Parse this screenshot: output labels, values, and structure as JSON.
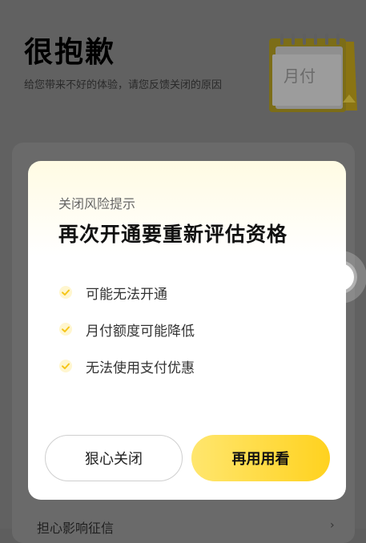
{
  "header": {
    "title": "很抱歉",
    "subtitle": "给您带来不好的体验，请您反馈关闭的原因",
    "calendar_text": "月付"
  },
  "background": {
    "bottom_item": "担心影响征信",
    "bottom_arrow": "›"
  },
  "modal": {
    "label": "关闭风险提示",
    "title": "再次开通要重新评估资格",
    "items": [
      {
        "text": "可能无法开通"
      },
      {
        "text": "月付额度可能降低"
      },
      {
        "text": "无法使用支付优惠"
      }
    ],
    "close_button": "狠心关闭",
    "retry_button": "再用用看"
  },
  "colors": {
    "accent": "#ffd21f",
    "check": "#f5c518",
    "overlay": "#616161"
  }
}
